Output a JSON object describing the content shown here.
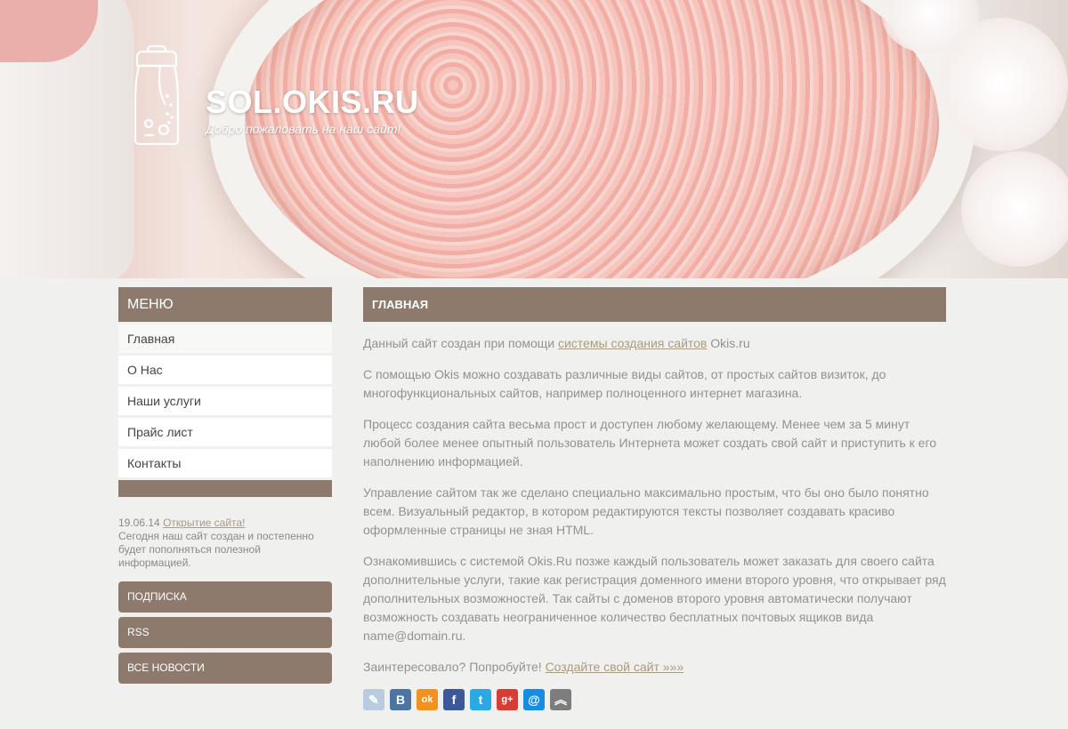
{
  "header": {
    "title": "SOL.OKIS.RU",
    "slogan": "Добро пожаловать на наш сайт!",
    "logo_icon": "salt-shaker-icon"
  },
  "sidebar": {
    "menu_title": "МЕНЮ",
    "items": [
      {
        "label": "Главная"
      },
      {
        "label": "О Нас"
      },
      {
        "label": "Наши услуги"
      },
      {
        "label": "Прайс лист"
      },
      {
        "label": "Контакты"
      }
    ],
    "news": {
      "date": "19.06.14",
      "title_link": "Открытие сайта!",
      "text": "Сегодня наш сайт создан и постепенно будет пополняться полезной информацией."
    },
    "buttons": [
      {
        "label": "ПОДПИСКА"
      },
      {
        "label": "RSS"
      },
      {
        "label": "ВСЕ НОВОСТИ"
      }
    ]
  },
  "content": {
    "heading": "ГЛАВНАЯ",
    "p1_before": "Данный сайт создан при помощи ",
    "p1_link": "системы создания сайтов",
    "p1_after": " Okis.ru",
    "p2": "С помощью Okis можно создавать различные виды сайтов, от простых сайтов визиток, до многофункциональных сайтов, например полноценного интернет магазина.",
    "p3": "Процесс создания сайта весьма прост и доступен любому желающему. Менее чем за 5 минут любой более менее опытный пользователь Интернета может создать свой сайт и приступить к его наполнению информацией.",
    "p4": "Управление сайтом так же сделано специально максимально простым, что бы оно было понятно всем. Визуальный редактор, в котором редактируются тексты позволяет создавать красиво оформленные страницы не зная HTML.",
    "p5": "Ознакомившись с системой Okis.Ru позже каждый пользователь может заказать для своего сайта дополнительные услуги, такие как регистрация доменного имени второго уровня, что открывает ряд дополнительных возможностей. Так сайты с доменов второго уровня автоматически получают возможность создавать неограниченное количество бесплатных почтовых ящиков вида name@domain.ru.",
    "p6_before": "Заинтересовало? Попробуйте! ",
    "p6_link": "Создайте свой сайт »»»"
  },
  "social": [
    {
      "name": "livejournal-icon",
      "glyph": "✎",
      "color": "#b9cbe0"
    },
    {
      "name": "vkontakte-icon",
      "glyph": "B",
      "color": "#4c75a3"
    },
    {
      "name": "odnoklassniki-icon",
      "glyph": "ok",
      "color": "#f39220"
    },
    {
      "name": "facebook-icon",
      "glyph": "f",
      "color": "#3b5998"
    },
    {
      "name": "twitter-icon",
      "glyph": "t",
      "color": "#2ba9e1"
    },
    {
      "name": "google-plus-icon",
      "glyph": "g+",
      "color": "#d73d32"
    },
    {
      "name": "mail-ru-icon",
      "glyph": "@",
      "color": "#168de2"
    },
    {
      "name": "more-share-icon",
      "glyph": "︽",
      "color": "#7d7d7d"
    }
  ]
}
